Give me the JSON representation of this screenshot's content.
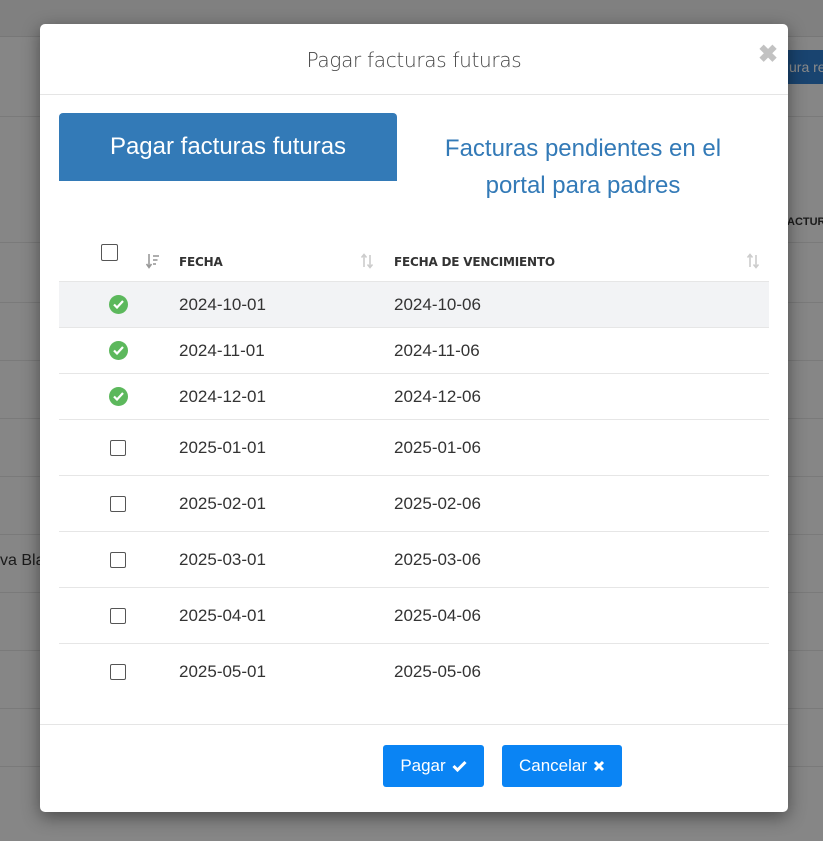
{
  "background": {
    "button_partial": "ura re",
    "column_partial": "ACTUR",
    "name_partial": "va Bla"
  },
  "modal": {
    "title": "Pagar facturas futuras",
    "close_icon": "close-icon"
  },
  "tabs": [
    {
      "label": "Pagar facturas futuras",
      "active": true
    },
    {
      "label_line1": "Facturas pendientes en el",
      "label_line2": "portal para padres",
      "active": false
    }
  ],
  "table": {
    "columns": [
      "FECHA",
      "FECHA DE VENCIMIENTO"
    ],
    "rows": [
      {
        "fecha": "2024-10-01",
        "vencimiento": "2024-10-06",
        "selected": true
      },
      {
        "fecha": "2024-11-01",
        "vencimiento": "2024-11-06",
        "selected": true
      },
      {
        "fecha": "2024-12-01",
        "vencimiento": "2024-12-06",
        "selected": true
      },
      {
        "fecha": "2025-01-01",
        "vencimiento": "2025-01-06",
        "selected": false
      },
      {
        "fecha": "2025-02-01",
        "vencimiento": "2025-02-06",
        "selected": false
      },
      {
        "fecha": "2025-03-01",
        "vencimiento": "2025-03-06",
        "selected": false
      },
      {
        "fecha": "2025-04-01",
        "vencimiento": "2025-04-06",
        "selected": false
      },
      {
        "fecha": "2025-05-01",
        "vencimiento": "2025-05-06",
        "selected": false
      }
    ]
  },
  "footer": {
    "pay_label": "Pagar",
    "cancel_label": "Cancelar"
  },
  "colors": {
    "primary": "#337ab7",
    "button": "#0a84f4",
    "success": "#5cb85c"
  }
}
